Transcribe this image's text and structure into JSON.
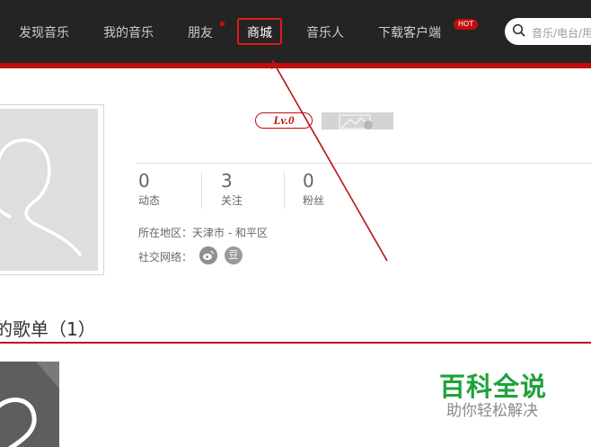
{
  "nav": {
    "items": [
      {
        "label": "发现音乐"
      },
      {
        "label": "我的音乐"
      },
      {
        "label": "朋友"
      },
      {
        "label": "商城"
      },
      {
        "label": "音乐人"
      },
      {
        "label": "下载客户端"
      }
    ],
    "hot_badge": "HOT",
    "search_placeholder": "音乐/电台/用户"
  },
  "profile": {
    "level": "Lv.0",
    "stats": [
      {
        "value": "0",
        "label": "动态"
      },
      {
        "value": "3",
        "label": "关注"
      },
      {
        "value": "0",
        "label": "粉丝"
      }
    ],
    "region": "所在地区：天津市 - 和平区",
    "social_label": "社交网络：",
    "social_icons": [
      "weibo-icon",
      "douban-icon"
    ],
    "douban_glyph": "豆"
  },
  "playlist": {
    "title": "的歌单（1）"
  },
  "watermark": {
    "title": "百科全说",
    "subtitle": "助你轻松解决"
  },
  "colors": {
    "topbar": "#242424",
    "accent": "#c20c0c",
    "highlight": "#e01b1b",
    "watermark": "#1fa23c"
  }
}
